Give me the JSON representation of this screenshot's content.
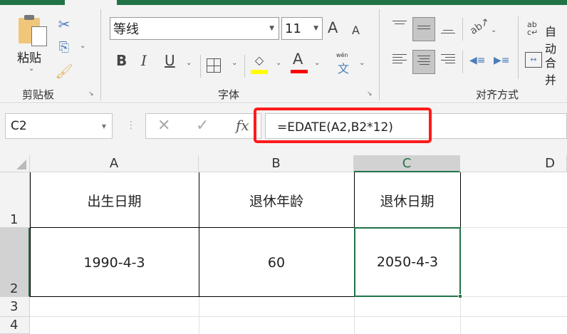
{
  "ribbon": {
    "clipboard": {
      "paste": "粘贴",
      "group": "剪贴板"
    },
    "font": {
      "name": "等线",
      "size": "11",
      "bold": "B",
      "italic": "I",
      "underline": "U",
      "wen": "wén",
      "wen_char": "文",
      "font_color": "A",
      "grow": "A",
      "shrink": "A",
      "group": "字体",
      "fill_color": "#ffff00",
      "text_color": "#ff0000"
    },
    "alignment": {
      "wrap": "自动",
      "merge": "合并",
      "group": "对齐方式"
    }
  },
  "formula_bar": {
    "name_box": "C2",
    "fx": "fx",
    "formula": "=EDATE(A2,B2*12)",
    "highlight_color": "#ff1a1a"
  },
  "sheet": {
    "columns": [
      "A",
      "B",
      "C",
      "D"
    ],
    "rows": [
      "1",
      "2",
      "3",
      "4"
    ],
    "cells": {
      "A1": "出生日期",
      "B1": "退休年龄",
      "C1": "退休日期",
      "A2": "1990-4-3",
      "B2": "60",
      "C2": "2050-4-3"
    },
    "selected_color": "#217346"
  }
}
